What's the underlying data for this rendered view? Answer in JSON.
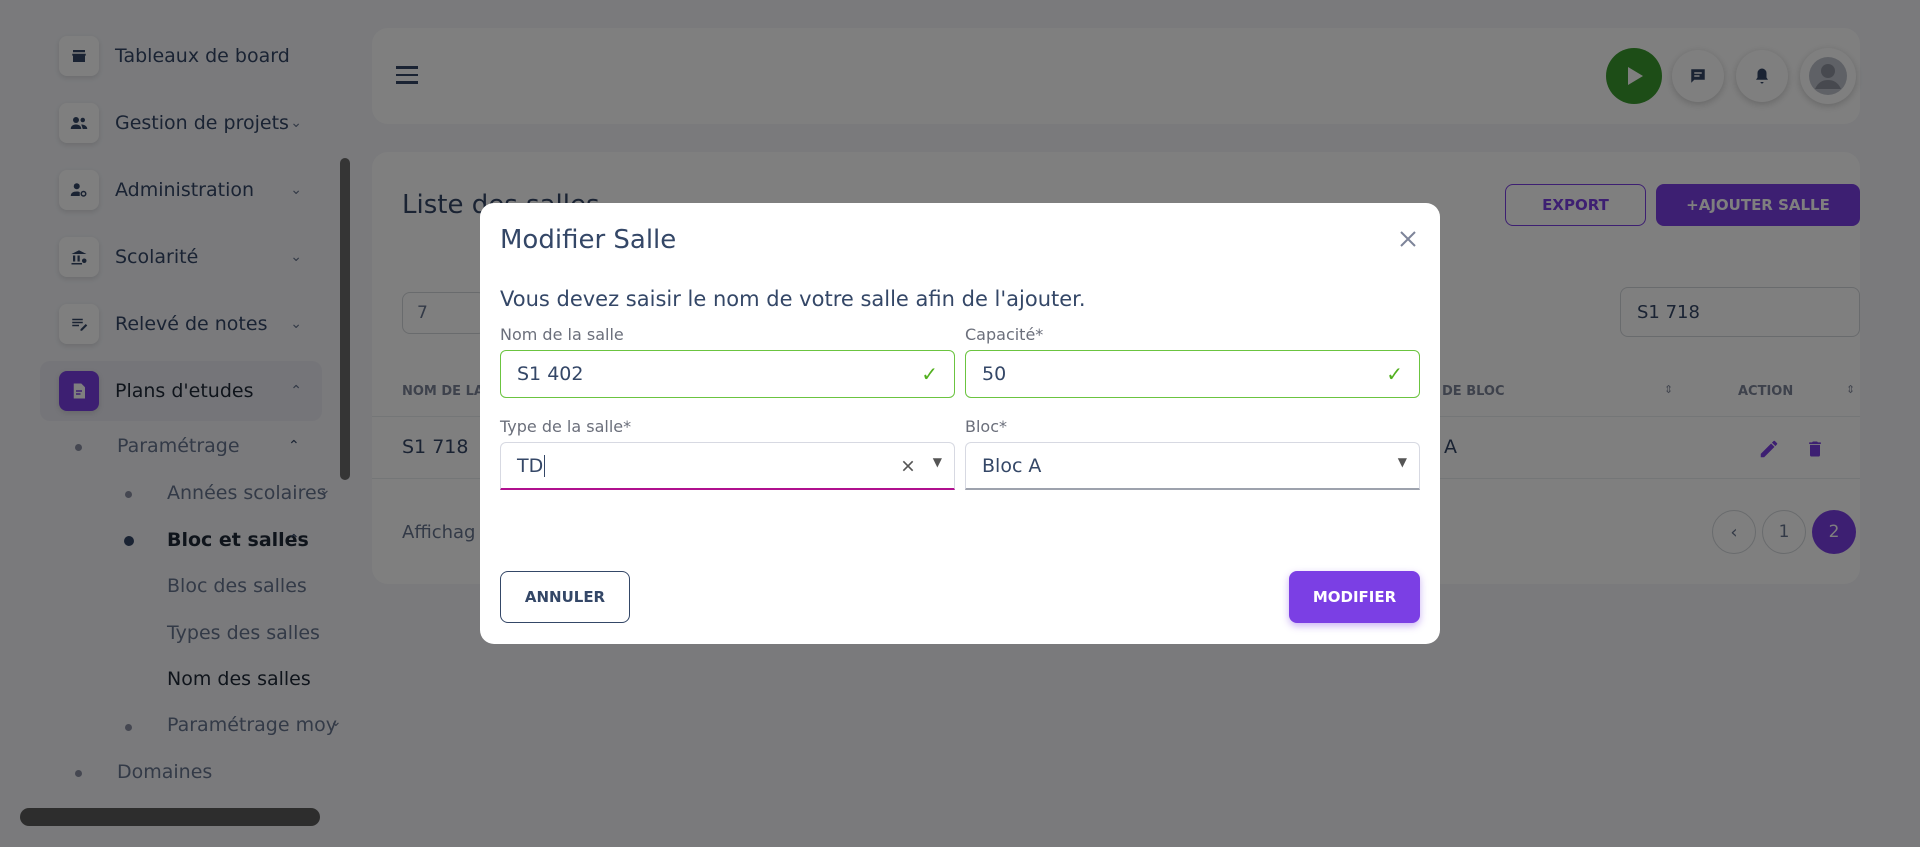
{
  "sidebar": {
    "items": [
      {
        "label": "Tableaux de board",
        "icon": "store-icon"
      },
      {
        "label": "Gestion de projets",
        "icon": "people-icon"
      },
      {
        "label": "Administration",
        "icon": "user-gear-icon"
      },
      {
        "label": "Scolarité",
        "icon": "bank-icon"
      },
      {
        "label": "Relevé de notes",
        "icon": "edit-notes-icon"
      },
      {
        "label": "Plans d'etudes",
        "icon": "document-icon"
      }
    ],
    "sub": {
      "parametrage": "Paramétrage",
      "annees": "Années scolaires",
      "bloc_et_salles": "Bloc et salles",
      "bloc_des_salles": "Bloc des salles",
      "types_des_salles": "Types des salles",
      "nom_des_salles": "Nom des salles",
      "parametrage_moy": "Paramétrage moy",
      "domaines": "Domaines"
    }
  },
  "page": {
    "title": "Liste des salles",
    "export_label": "EXPORT",
    "add_label": "+AJOUTER SALLE",
    "rows_per_page_value": "7",
    "search_value": "S1 718",
    "columns": [
      "NOM DE LA S",
      "DE BLOC",
      "ACTION"
    ],
    "row": {
      "name": "S1 718",
      "bloc": "A"
    },
    "footer_text": "Affichag",
    "pages": [
      "1",
      "2"
    ]
  },
  "modal": {
    "title": "Modifier Salle",
    "subtitle": "Vous devez saisir le nom de votre salle afin de l'ajouter.",
    "nom_label": "Nom de la salle",
    "nom_value": "S1 402",
    "capacite_label": "Capacité*",
    "capacite_value": "50",
    "type_label": "Type de la salle*",
    "type_value": "TD",
    "bloc_label": "Bloc*",
    "bloc_value": "Bloc A",
    "cancel_label": "ANNULER",
    "submit_label": "MODIFIER"
  },
  "colors": {
    "accent": "#7b3fe4",
    "valid": "#6bc440",
    "focus": "#b0108e",
    "play": "#3b9b2f"
  }
}
